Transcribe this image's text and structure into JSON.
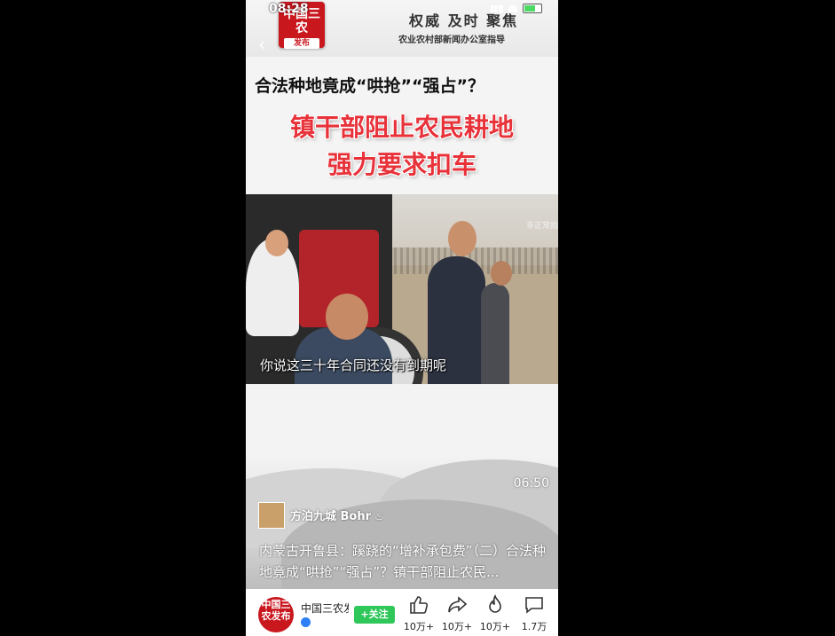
{
  "status": {
    "time": "08:28"
  },
  "header": {
    "logo_line1": "中国三农",
    "logo_line2": "发布",
    "slogan": "权威 及时 聚焦",
    "guide": "农业农村部新闻办公室指导"
  },
  "title": {
    "question": "合法种地竟成“哄抢”“强占”？",
    "red_line1": "镇干部阻止农民耕地",
    "red_line2": "强力要求扣车"
  },
  "video": {
    "watermark": "非正常拍",
    "subtitle": "你说这三十年合同还没有到期呢",
    "duration": "06:50"
  },
  "author": {
    "name": "方泊九城 Bohr"
  },
  "description": "内蒙古开鲁县：蹊跷的“增补承包费”（二）合法种地竟成“哄抢”“强占”？镇干部阻止农民...",
  "bottom_bar": {
    "avatar_text": "中国三农发布",
    "account_name": "中国三农发",
    "follow_label": "+关注",
    "actions": [
      {
        "icon": "thumbs-up-icon",
        "count": "10万+"
      },
      {
        "icon": "share-icon",
        "count": "10万+"
      },
      {
        "icon": "flame-icon",
        "count": "10万+"
      },
      {
        "icon": "comment-icon",
        "count": "1.7万"
      }
    ]
  }
}
